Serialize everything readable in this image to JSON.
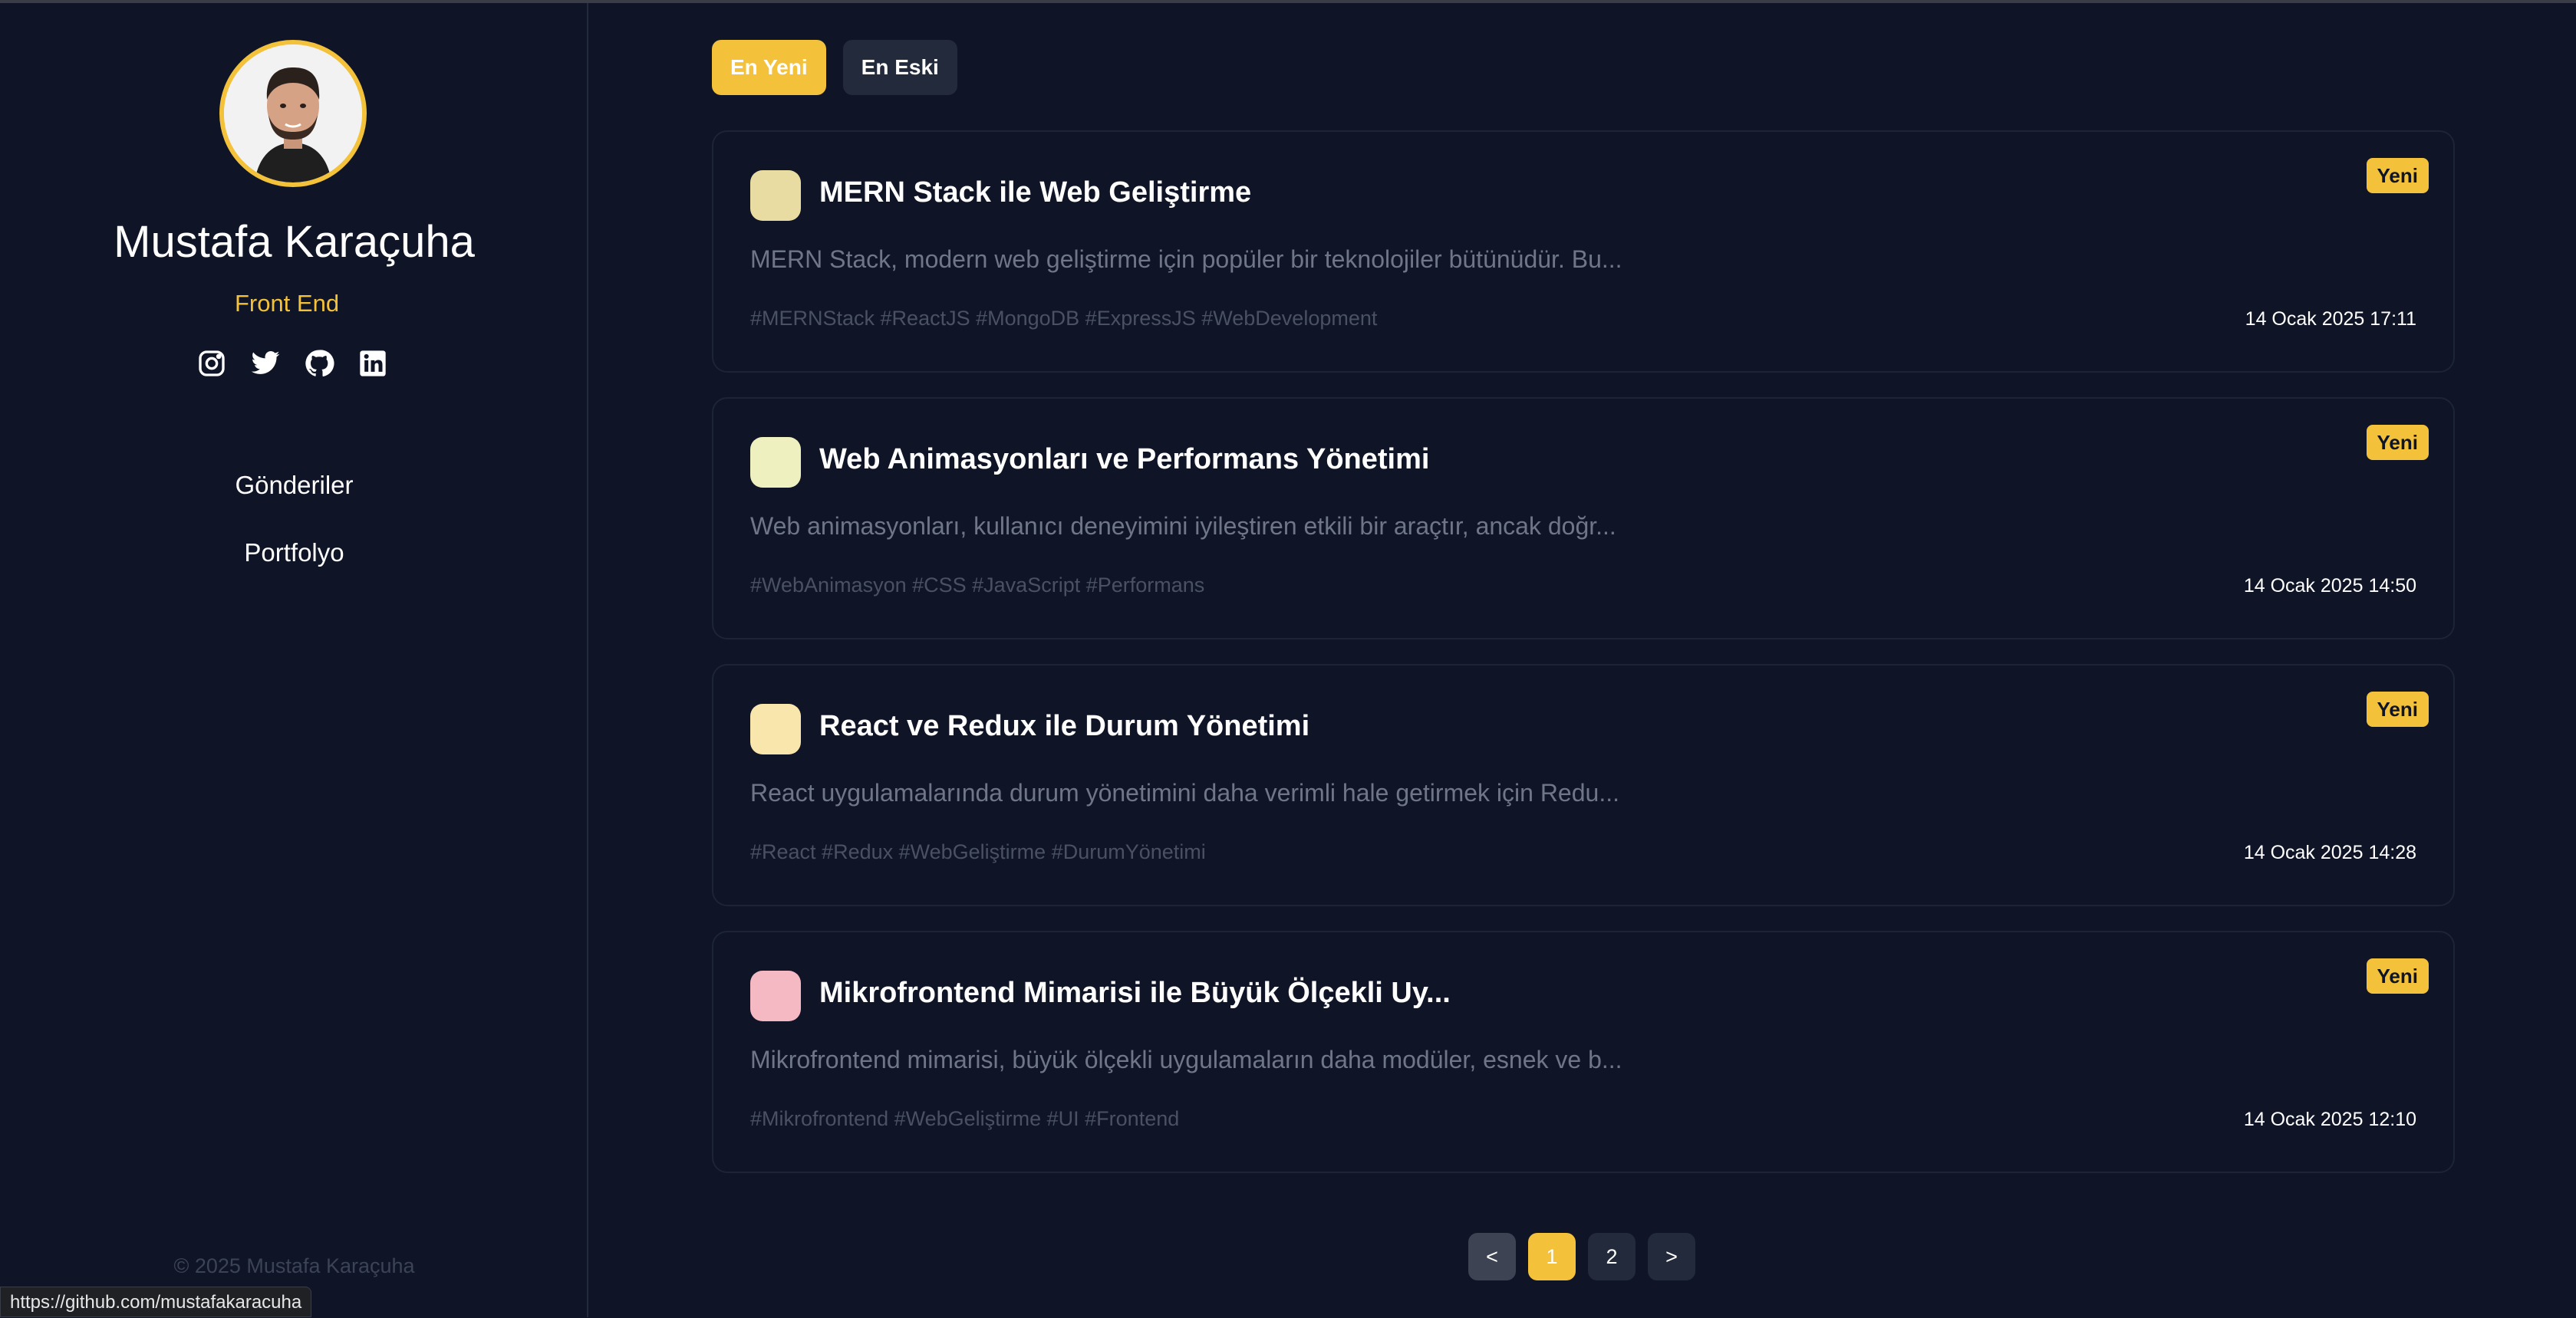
{
  "colors": {
    "background": "#0f1527",
    "accent": "#f3c13a",
    "card_border": "#1d2436",
    "muted_text": "#6f7688"
  },
  "profile": {
    "name": "Mustafa Karaçuha",
    "role": "Front End",
    "avatar_icon": "portrait-photo",
    "socials": [
      {
        "icon": "instagram-icon"
      },
      {
        "icon": "twitter-icon"
      },
      {
        "icon": "github-icon"
      },
      {
        "icon": "linkedin-icon"
      }
    ]
  },
  "nav": {
    "items": [
      {
        "label": "Gönderiler"
      },
      {
        "label": "Portfolyo"
      }
    ]
  },
  "footer": {
    "copyright": "© 2025 Mustafa Karaçuha"
  },
  "status_bar": {
    "url": "https://github.com/mustafakaracuha"
  },
  "sort": {
    "newest": "En Yeni",
    "oldest": "En Eski",
    "selected": "En Yeni"
  },
  "posts": [
    {
      "title": "MERN Stack ile Web Geliştirme",
      "excerpt": "MERN Stack, modern web geliştirme için popüler bir teknolojiler bütünüdür. Bu...",
      "tags": "#MERNStack #ReactJS #MongoDB #ExpressJS #WebDevelopment",
      "date": "14 Ocak 2025 17:11",
      "badge": "Yeni",
      "swatch_color": "#e8dca3"
    },
    {
      "title": "Web Animasyonları ve Performans Yönetimi",
      "excerpt": "Web animasyonları, kullanıcı deneyimini iyileştiren etkili bir araçtır, ancak doğr...",
      "tags": "#WebAnimasyon #CSS #JavaScript #Performans",
      "date": "14 Ocak 2025 14:50",
      "badge": "Yeni",
      "swatch_color": "#eff0c0"
    },
    {
      "title": "React ve Redux ile Durum Yönetimi",
      "excerpt": "React uygulamalarında durum yönetimini daha verimli hale getirmek için Redu...",
      "tags": "#React #Redux #WebGeliştirme #DurumYönetimi",
      "date": "14 Ocak 2025 14:28",
      "badge": "Yeni",
      "swatch_color": "#f8e6ac"
    },
    {
      "title": "Mikrofrontend Mimarisi ile Büyük Ölçekli Uy...",
      "excerpt": "Mikrofrontend mimarisi, büyük ölçekli uygulamaların daha modüler, esnek ve b...",
      "tags": "#Mikrofrontend #WebGeliştirme #UI #Frontend",
      "date": "14 Ocak 2025 12:10",
      "badge": "Yeni",
      "swatch_color": "#f4b9c2"
    }
  ],
  "pagination": {
    "prev": "<",
    "pages": [
      "1",
      "2"
    ],
    "current": "1",
    "next": ">"
  }
}
